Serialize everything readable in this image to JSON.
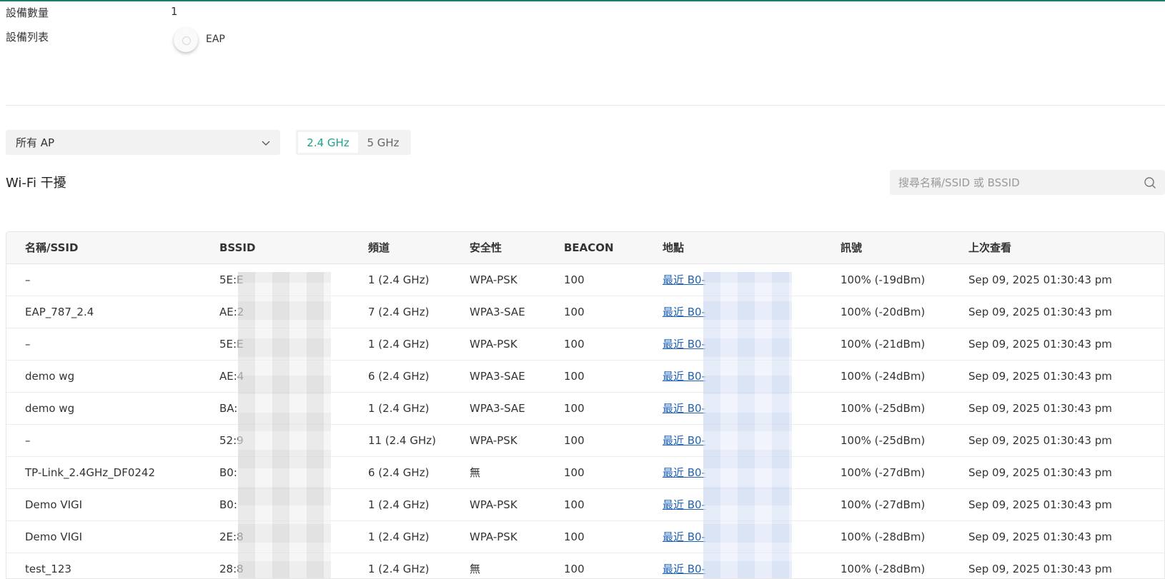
{
  "info": {
    "device_count_label": "設備數量",
    "device_count_value": "1",
    "device_list_label": "設備列表",
    "device_name": "EAP"
  },
  "filters": {
    "ap_select_value": "所有 AP",
    "freq_24": "2.4 GHz",
    "freq_5": "5 GHz",
    "active_freq": "2.4 GHz"
  },
  "section_title": "Wi-Fi 干擾",
  "search": {
    "placeholder": "搜尋名稱/SSID 或 BSSID"
  },
  "table": {
    "headers": [
      "名稱/SSID",
      "BSSID",
      "頻道",
      "安全性",
      "BEACON",
      "地點",
      "訊號",
      "上次查看"
    ],
    "rows": [
      {
        "ssid": "–",
        "bssid": "5E:E",
        "channel": "1 (2.4 GHz)",
        "security": "WPA-PSK",
        "beacon": "100",
        "location": "最近 B0-",
        "signal": "100% (-19dBm)",
        "last_seen": "Sep 09, 2025 01:30:43 pm"
      },
      {
        "ssid": "EAP_787_2.4",
        "bssid": "AE:2",
        "channel": "7 (2.4 GHz)",
        "security": "WPA3-SAE",
        "beacon": "100",
        "location": "最近 B0-",
        "signal": "100% (-20dBm)",
        "last_seen": "Sep 09, 2025 01:30:43 pm"
      },
      {
        "ssid": "–",
        "bssid": "5E:E",
        "channel": "1 (2.4 GHz)",
        "security": "WPA-PSK",
        "beacon": "100",
        "location": "最近 B0-",
        "signal": "100% (-21dBm)",
        "last_seen": "Sep 09, 2025 01:30:43 pm"
      },
      {
        "ssid": "demo wg",
        "bssid": "AE:4",
        "channel": "6 (2.4 GHz)",
        "security": "WPA3-SAE",
        "beacon": "100",
        "location": "最近 B0-",
        "signal": "100% (-24dBm)",
        "last_seen": "Sep 09, 2025 01:30:43 pm"
      },
      {
        "ssid": "demo wg",
        "bssid": "BA:",
        "channel": "1 (2.4 GHz)",
        "security": "WPA3-SAE",
        "beacon": "100",
        "location": "最近 B0-",
        "signal": "100% (-25dBm)",
        "last_seen": "Sep 09, 2025 01:30:43 pm"
      },
      {
        "ssid": "–",
        "bssid": "52:9",
        "channel": "11 (2.4 GHz)",
        "security": "WPA-PSK",
        "beacon": "100",
        "location": "最近 B0-",
        "signal": "100% (-25dBm)",
        "last_seen": "Sep 09, 2025 01:30:43 pm"
      },
      {
        "ssid": "TP-Link_2.4GHz_DF0242",
        "bssid": "B0:",
        "channel": "6 (2.4 GHz)",
        "security": "無",
        "beacon": "100",
        "location": "最近 B0-",
        "signal": "100% (-27dBm)",
        "last_seen": "Sep 09, 2025 01:30:43 pm"
      },
      {
        "ssid": "Demo VIGI",
        "bssid": "B0:",
        "channel": "1 (2.4 GHz)",
        "security": "WPA-PSK",
        "beacon": "100",
        "location": "最近 B0-",
        "signal": "100% (-27dBm)",
        "last_seen": "Sep 09, 2025 01:30:43 pm"
      },
      {
        "ssid": "Demo VIGI",
        "bssid": "2E:8",
        "channel": "1 (2.4 GHz)",
        "security": "WPA-PSK",
        "beacon": "100",
        "location": "最近 B0-",
        "signal": "100% (-28dBm)",
        "last_seen": "Sep 09, 2025 01:30:43 pm"
      },
      {
        "ssid": "test_123",
        "bssid": "28:8",
        "channel": "1 (2.4 GHz)",
        "security": "無",
        "beacon": "100",
        "location": "最近 B0-",
        "signal": "100% (-28dBm)",
        "last_seen": "Sep 09, 2025 01:30:43 pm"
      }
    ]
  },
  "colors": {
    "accent": "#1aa38a",
    "link": "#1f63b8",
    "topline": "#1c7c6a"
  }
}
